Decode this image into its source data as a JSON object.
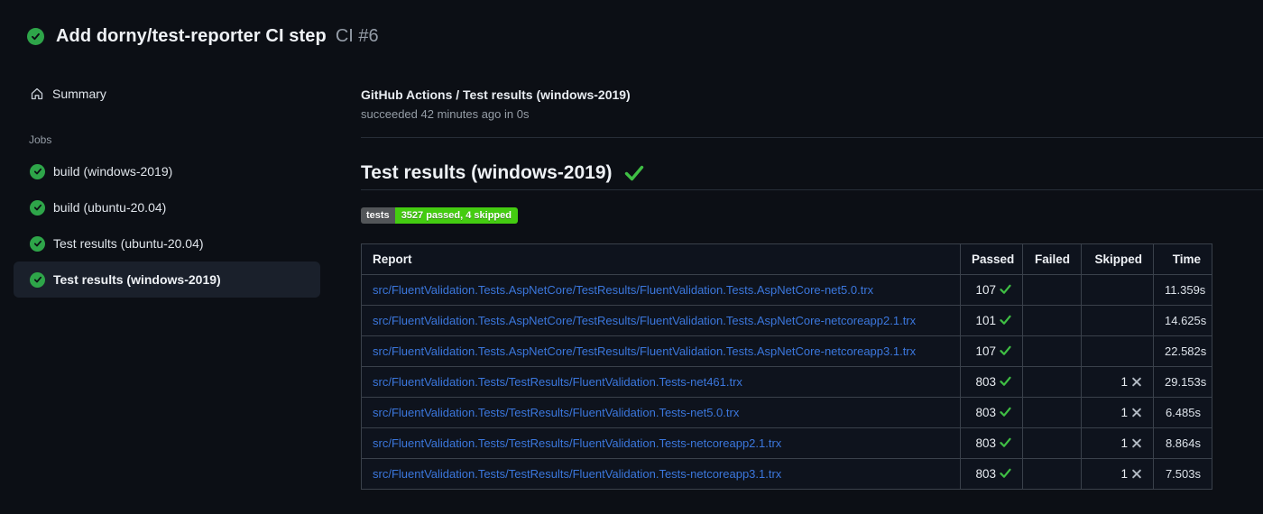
{
  "run_header": {
    "title": "Add dorny/test-reporter CI step",
    "run_ref": "CI #6",
    "status": "success"
  },
  "sidebar": {
    "summary_label": "Summary",
    "jobs_label": "Jobs",
    "jobs": [
      {
        "label": "build (windows-2019)",
        "status": "success",
        "selected": false
      },
      {
        "label": "build (ubuntu-20.04)",
        "status": "success",
        "selected": false
      },
      {
        "label": "Test results (ubuntu-20.04)",
        "status": "success",
        "selected": false
      },
      {
        "label": "Test results (windows-2019)",
        "status": "success",
        "selected": true
      }
    ]
  },
  "main": {
    "check_title": "GitHub Actions / Test results (windows-2019)",
    "check_status": "succeeded 42 minutes ago in 0s",
    "section_title": "Test results (windows-2019)",
    "section_status": "success",
    "badge": {
      "label": "tests",
      "value": "3527 passed, 4 skipped"
    },
    "table": {
      "columns": [
        "Report",
        "Passed",
        "Failed",
        "Skipped",
        "Time"
      ],
      "rows": [
        {
          "report": "src/FluentValidation.Tests.AspNetCore/TestResults/FluentValidation.Tests.AspNetCore-net5.0.trx",
          "passed": "107",
          "failed": "",
          "skipped": "",
          "time": "11.359s"
        },
        {
          "report": "src/FluentValidation.Tests.AspNetCore/TestResults/FluentValidation.Tests.AspNetCore-netcoreapp2.1.trx",
          "passed": "101",
          "failed": "",
          "skipped": "",
          "time": "14.625s"
        },
        {
          "report": "src/FluentValidation.Tests.AspNetCore/TestResults/FluentValidation.Tests.AspNetCore-netcoreapp3.1.trx",
          "passed": "107",
          "failed": "",
          "skipped": "",
          "time": "22.582s"
        },
        {
          "report": "src/FluentValidation.Tests/TestResults/FluentValidation.Tests-net461.trx",
          "passed": "803",
          "failed": "",
          "skipped": "1",
          "time": "29.153s"
        },
        {
          "report": "src/FluentValidation.Tests/TestResults/FluentValidation.Tests-net5.0.trx",
          "passed": "803",
          "failed": "",
          "skipped": "1",
          "time": "6.485s"
        },
        {
          "report": "src/FluentValidation.Tests/TestResults/FluentValidation.Tests-netcoreapp2.1.trx",
          "passed": "803",
          "failed": "",
          "skipped": "1",
          "time": "8.864s"
        },
        {
          "report": "src/FluentValidation.Tests/TestResults/FluentValidation.Tests-netcoreapp3.1.trx",
          "passed": "803",
          "failed": "",
          "skipped": "1",
          "time": "7.503s"
        }
      ]
    }
  },
  "colors": {
    "success_circle": "#2ea549",
    "check_green": "#3fbf44",
    "link_blue": "#3b77dd",
    "badge_label_bg": "#535659",
    "badge_value_bg": "#44cc11",
    "skip_x_gray": "#b2bac3"
  }
}
